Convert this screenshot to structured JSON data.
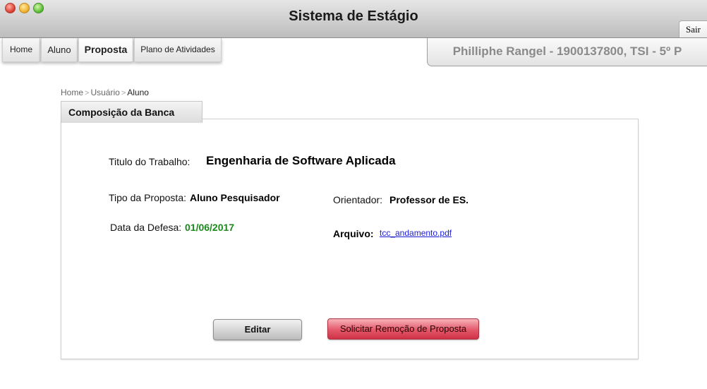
{
  "window": {
    "title": "Sistema de Estágio",
    "logout_label": "Sair"
  },
  "nav": {
    "tabs": [
      {
        "label": "Home"
      },
      {
        "label": "Aluno"
      },
      {
        "label": "Proposta",
        "active": true
      },
      {
        "label": "Plano de Atividades"
      }
    ]
  },
  "user": {
    "info": "Philliphe Rangel - 1900137800, TSI - 5º P"
  },
  "breadcrumb": {
    "items": [
      "Home",
      "Usuário",
      "Aluno"
    ],
    "separator": ">"
  },
  "panel": {
    "header": "Composição da Banca",
    "titulo_label": "Titulo do Trabalho:",
    "titulo_value": "Engenharia de Software Aplicada",
    "tipo_label": "Tipo da Proposta:",
    "tipo_value": "Aluno Pesquisador",
    "orientador_label": "Orientador:",
    "orientador_value": "Professor de ES.",
    "data_label": "Data da Defesa:",
    "data_value": "01/06/2017",
    "arquivo_label": "Arquivo:",
    "arquivo_value": "tcc_andamento.pdf"
  },
  "actions": {
    "edit_label": "Editar",
    "remove_label": "Solicitar Remoção de Proposta"
  },
  "colors": {
    "date_green": "#1a8a1a",
    "link_blue": "#1b1bd6",
    "remove_red": "#e4576a"
  }
}
